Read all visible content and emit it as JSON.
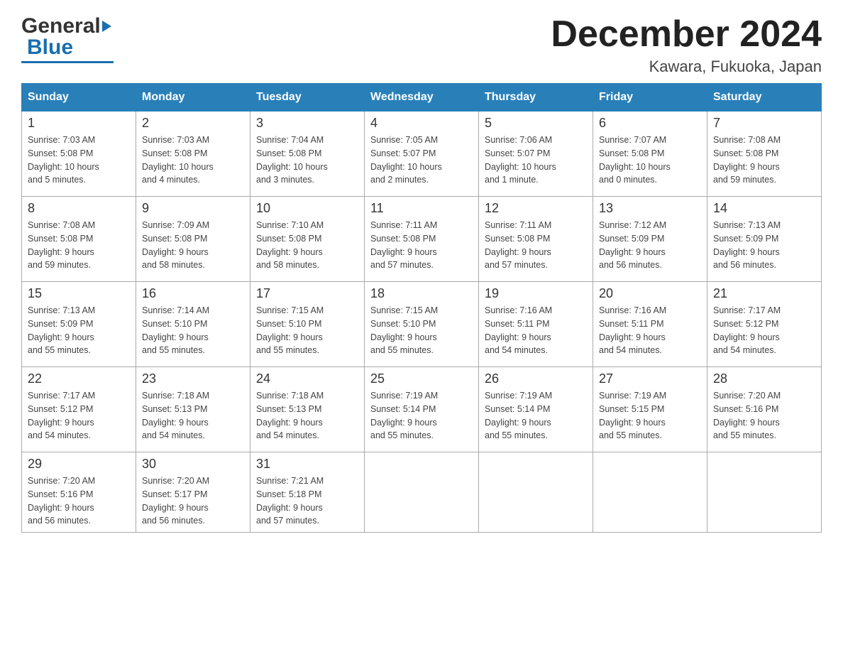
{
  "header": {
    "title": "December 2024",
    "subtitle": "Kawara, Fukuoka, Japan",
    "logo_general": "General",
    "logo_blue": "Blue"
  },
  "days_of_week": [
    "Sunday",
    "Monday",
    "Tuesday",
    "Wednesday",
    "Thursday",
    "Friday",
    "Saturday"
  ],
  "weeks": [
    [
      {
        "day": "1",
        "sunrise": "7:03 AM",
        "sunset": "5:08 PM",
        "daylight": "10 hours and 5 minutes."
      },
      {
        "day": "2",
        "sunrise": "7:03 AM",
        "sunset": "5:08 PM",
        "daylight": "10 hours and 4 minutes."
      },
      {
        "day": "3",
        "sunrise": "7:04 AM",
        "sunset": "5:08 PM",
        "daylight": "10 hours and 3 minutes."
      },
      {
        "day": "4",
        "sunrise": "7:05 AM",
        "sunset": "5:07 PM",
        "daylight": "10 hours and 2 minutes."
      },
      {
        "day": "5",
        "sunrise": "7:06 AM",
        "sunset": "5:07 PM",
        "daylight": "10 hours and 1 minute."
      },
      {
        "day": "6",
        "sunrise": "7:07 AM",
        "sunset": "5:08 PM",
        "daylight": "10 hours and 0 minutes."
      },
      {
        "day": "7",
        "sunrise": "7:08 AM",
        "sunset": "5:08 PM",
        "daylight": "9 hours and 59 minutes."
      }
    ],
    [
      {
        "day": "8",
        "sunrise": "7:08 AM",
        "sunset": "5:08 PM",
        "daylight": "9 hours and 59 minutes."
      },
      {
        "day": "9",
        "sunrise": "7:09 AM",
        "sunset": "5:08 PM",
        "daylight": "9 hours and 58 minutes."
      },
      {
        "day": "10",
        "sunrise": "7:10 AM",
        "sunset": "5:08 PM",
        "daylight": "9 hours and 58 minutes."
      },
      {
        "day": "11",
        "sunrise": "7:11 AM",
        "sunset": "5:08 PM",
        "daylight": "9 hours and 57 minutes."
      },
      {
        "day": "12",
        "sunrise": "7:11 AM",
        "sunset": "5:08 PM",
        "daylight": "9 hours and 57 minutes."
      },
      {
        "day": "13",
        "sunrise": "7:12 AM",
        "sunset": "5:09 PM",
        "daylight": "9 hours and 56 minutes."
      },
      {
        "day": "14",
        "sunrise": "7:13 AM",
        "sunset": "5:09 PM",
        "daylight": "9 hours and 56 minutes."
      }
    ],
    [
      {
        "day": "15",
        "sunrise": "7:13 AM",
        "sunset": "5:09 PM",
        "daylight": "9 hours and 55 minutes."
      },
      {
        "day": "16",
        "sunrise": "7:14 AM",
        "sunset": "5:10 PM",
        "daylight": "9 hours and 55 minutes."
      },
      {
        "day": "17",
        "sunrise": "7:15 AM",
        "sunset": "5:10 PM",
        "daylight": "9 hours and 55 minutes."
      },
      {
        "day": "18",
        "sunrise": "7:15 AM",
        "sunset": "5:10 PM",
        "daylight": "9 hours and 55 minutes."
      },
      {
        "day": "19",
        "sunrise": "7:16 AM",
        "sunset": "5:11 PM",
        "daylight": "9 hours and 54 minutes."
      },
      {
        "day": "20",
        "sunrise": "7:16 AM",
        "sunset": "5:11 PM",
        "daylight": "9 hours and 54 minutes."
      },
      {
        "day": "21",
        "sunrise": "7:17 AM",
        "sunset": "5:12 PM",
        "daylight": "9 hours and 54 minutes."
      }
    ],
    [
      {
        "day": "22",
        "sunrise": "7:17 AM",
        "sunset": "5:12 PM",
        "daylight": "9 hours and 54 minutes."
      },
      {
        "day": "23",
        "sunrise": "7:18 AM",
        "sunset": "5:13 PM",
        "daylight": "9 hours and 54 minutes."
      },
      {
        "day": "24",
        "sunrise": "7:18 AM",
        "sunset": "5:13 PM",
        "daylight": "9 hours and 54 minutes."
      },
      {
        "day": "25",
        "sunrise": "7:19 AM",
        "sunset": "5:14 PM",
        "daylight": "9 hours and 55 minutes."
      },
      {
        "day": "26",
        "sunrise": "7:19 AM",
        "sunset": "5:14 PM",
        "daylight": "9 hours and 55 minutes."
      },
      {
        "day": "27",
        "sunrise": "7:19 AM",
        "sunset": "5:15 PM",
        "daylight": "9 hours and 55 minutes."
      },
      {
        "day": "28",
        "sunrise": "7:20 AM",
        "sunset": "5:16 PM",
        "daylight": "9 hours and 55 minutes."
      }
    ],
    [
      {
        "day": "29",
        "sunrise": "7:20 AM",
        "sunset": "5:16 PM",
        "daylight": "9 hours and 56 minutes."
      },
      {
        "day": "30",
        "sunrise": "7:20 AM",
        "sunset": "5:17 PM",
        "daylight": "9 hours and 56 minutes."
      },
      {
        "day": "31",
        "sunrise": "7:21 AM",
        "sunset": "5:18 PM",
        "daylight": "9 hours and 57 minutes."
      },
      {
        "day": "",
        "sunrise": "",
        "sunset": "",
        "daylight": ""
      },
      {
        "day": "",
        "sunrise": "",
        "sunset": "",
        "daylight": ""
      },
      {
        "day": "",
        "sunrise": "",
        "sunset": "",
        "daylight": ""
      },
      {
        "day": "",
        "sunrise": "",
        "sunset": "",
        "daylight": ""
      }
    ]
  ],
  "labels": {
    "sunrise": "Sunrise:",
    "sunset": "Sunset:",
    "daylight": "Daylight:"
  }
}
